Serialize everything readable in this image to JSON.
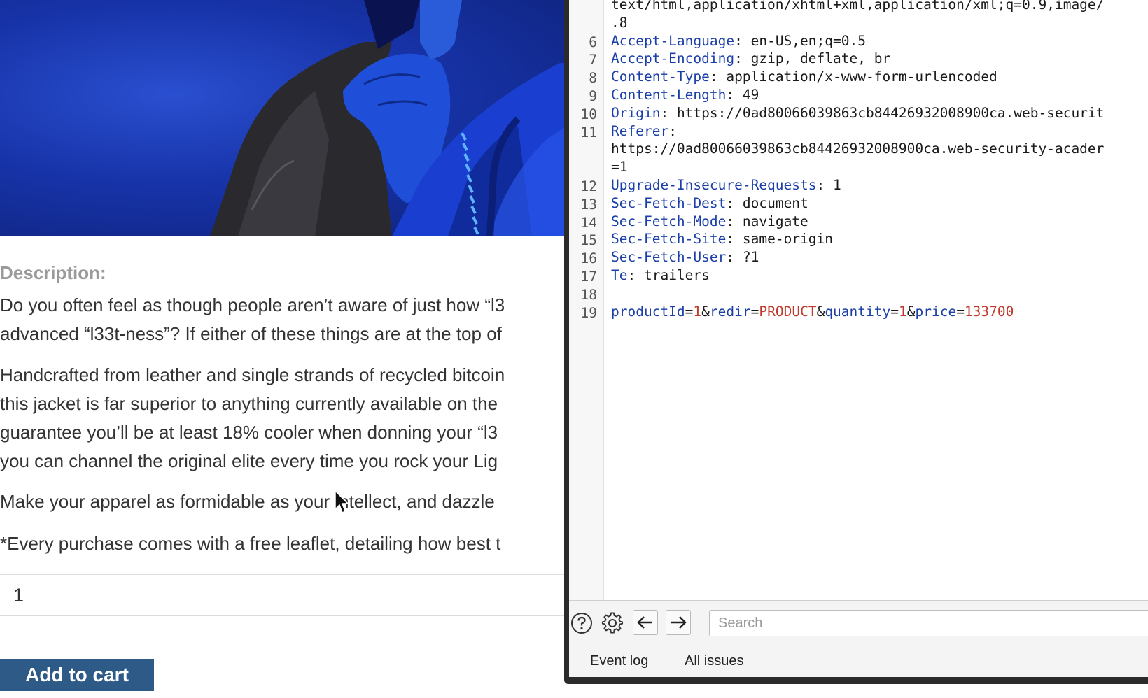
{
  "product": {
    "description_heading": "Description:",
    "paragraphs": [
      [
        "Do you often feel as though people aren’t aware of just how “l3",
        "advanced “l33t-ness”? If either of these things are at the top of"
      ],
      [
        "Handcrafted from leather and single strands of recycled bitcoin",
        "this jacket is far superior to anything currently available on the",
        "guarantee you’ll be at least 18% cooler when donning your “l3",
        "you can channel the original elite every time you rock your Lig"
      ],
      [
        "Make your apparel as formidable as your intellect, and dazzle"
      ],
      [
        "*Every purchase comes with a free leaflet, detailing how best t"
      ]
    ],
    "quantity_value": "1",
    "add_to_cart_label": "Add to cart"
  },
  "request": {
    "lines": [
      {
        "n": "",
        "text": "text/html,application/xhtml+xml,application/xml;q=0.9,image/"
      },
      {
        "n": "",
        "text": ".8"
      },
      {
        "n": "6",
        "key": "Accept-Language",
        "value": " en-US,en;q=0.5"
      },
      {
        "n": "7",
        "key": "Accept-Encoding",
        "value": " gzip, deflate, br"
      },
      {
        "n": "8",
        "key": "Content-Type",
        "value": " application/x-www-form-urlencoded"
      },
      {
        "n": "9",
        "key": "Content-Length",
        "value": " 49"
      },
      {
        "n": "10",
        "key": "Origin",
        "value": " https://0ad80066039863cb84426932008900ca.web-securit"
      },
      {
        "n": "11",
        "key": "Referer",
        "value": ""
      },
      {
        "n": "",
        "text": "https://0ad80066039863cb84426932008900ca.web-security-acader"
      },
      {
        "n": "",
        "text": "=1"
      },
      {
        "n": "12",
        "key": "Upgrade-Insecure-Requests",
        "value": " 1"
      },
      {
        "n": "13",
        "key": "Sec-Fetch-Dest",
        "value": " document"
      },
      {
        "n": "14",
        "key": "Sec-Fetch-Mode",
        "value": " navigate"
      },
      {
        "n": "15",
        "key": "Sec-Fetch-Site",
        "value": " same-origin"
      },
      {
        "n": "16",
        "key": "Sec-Fetch-User",
        "value": " ?1"
      },
      {
        "n": "17",
        "key": "Te",
        "value": " trailers"
      },
      {
        "n": "18",
        "text": ""
      },
      {
        "n": "19",
        "body": true
      }
    ],
    "body_params": [
      {
        "key": "productId",
        "value": "1"
      },
      {
        "key": "redir",
        "value": "PRODUCT"
      },
      {
        "key": "quantity",
        "value": "1"
      },
      {
        "key": "price",
        "value": "133700"
      }
    ]
  },
  "toolbar": {
    "search_placeholder": "Search"
  },
  "tabs": [
    {
      "label": "Event log"
    },
    {
      "label": "All issues"
    }
  ],
  "colors": {
    "header_key": "#1b3fa8",
    "param_value": "#c0392b",
    "button_bg": "#2e5a87"
  }
}
